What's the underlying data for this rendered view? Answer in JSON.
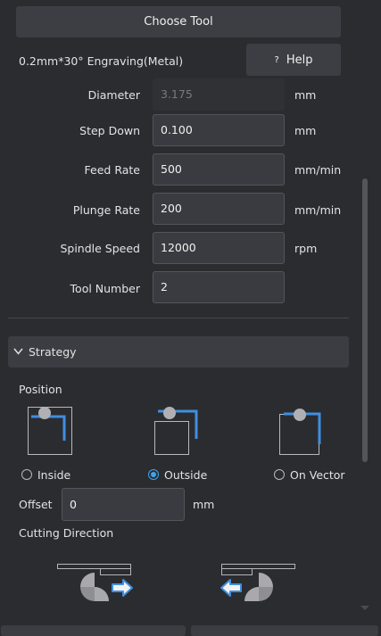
{
  "choose_tool_label": "Choose Tool",
  "tool_name": "0.2mm*30° Engraving(Metal)",
  "help": {
    "icon": "?",
    "label": "Help"
  },
  "params": [
    {
      "label": "Diameter",
      "value": "3.175",
      "unit": "mm",
      "disabled": true
    },
    {
      "label": "Step Down",
      "value": "0.100",
      "unit": "mm"
    },
    {
      "label": "Feed Rate",
      "value": "500",
      "unit": "mm/min"
    },
    {
      "label": "Plunge Rate",
      "value": "200",
      "unit": "mm/min"
    },
    {
      "label": "Spindle Speed",
      "value": "12000",
      "unit": "rpm"
    },
    {
      "label": "Tool Number",
      "value": "2",
      "unit": ""
    }
  ],
  "strategy": {
    "title": "Strategy",
    "position_label": "Position",
    "options": [
      "Inside",
      "Outside",
      "On Vector"
    ],
    "selected": "Outside",
    "offset_label": "Offset",
    "offset_value": "0",
    "offset_unit": "mm",
    "cutting_direction_label": "Cutting Direction"
  },
  "colors": {
    "accent": "#3fa4f0",
    "background": "#2b2c30",
    "field": "#3a3b40"
  }
}
